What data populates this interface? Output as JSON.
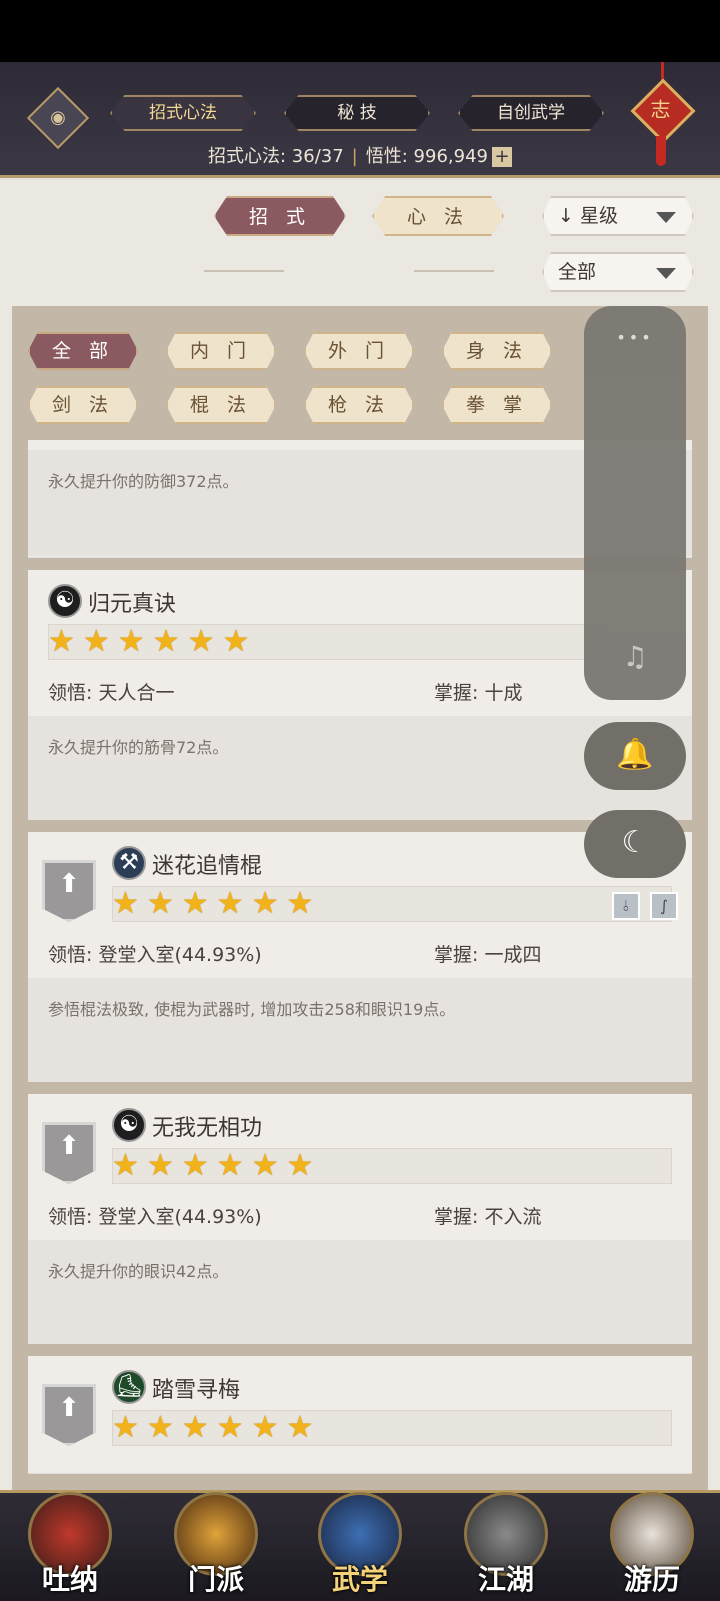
{
  "topbar": {
    "tabs": [
      {
        "label": "招式心法",
        "active": true
      },
      {
        "label": "秘 技",
        "active": false
      },
      {
        "label": "自创武学",
        "active": false
      }
    ],
    "counter_label": "招式心法: 36/37",
    "insight_label": "悟性: 996,949",
    "plus": "+",
    "badge_char": "志"
  },
  "subtabs": {
    "active": "招 式",
    "inactive": "心 法"
  },
  "sort": {
    "label": "星级",
    "arrow": "↓",
    "filter": "全部"
  },
  "chips_row1": [
    "全 部",
    "内 门",
    "外 门",
    "身 法"
  ],
  "chips_row2": [
    "剑 法",
    "棍 法",
    "枪 法",
    "拳 掌"
  ],
  "cards": [
    {
      "desc": "永久提升你的防御372点。"
    },
    {
      "name": "归元真诀",
      "icon": "☯",
      "insight": "领悟: 天人合一",
      "mastery": "掌握: 十成",
      "desc": "永久提升你的筋骨72点。",
      "stars": 6
    },
    {
      "name": "迷花追情棍",
      "icon": "⚒",
      "insight": "领悟: 登堂入室(44.93%)",
      "mastery": "掌握: 一成四",
      "desc": "参悟棍法极致, 使棍为武器时, 增加攻击258和眼识19点。",
      "stars": 6
    },
    {
      "name": "无我无相功",
      "icon": "☯",
      "insight": "领悟: 登堂入室(44.93%)",
      "mastery": "掌握: 不入流",
      "desc": "永久提升你的眼识42点。",
      "stars": 6
    },
    {
      "name": "踏雪寻梅",
      "icon": "⛸",
      "stars": 6
    }
  ],
  "overlay": {
    "dots": "•••",
    "music_icon": "music-off-icon",
    "bell_icon": "bell-icon",
    "moon_icon": "moon-icon"
  },
  "bottomnav": [
    {
      "label": "吐纳",
      "active": false,
      "color": "#c0392b"
    },
    {
      "label": "门派",
      "active": false,
      "color": "#e0a33a"
    },
    {
      "label": "武学",
      "active": true,
      "color": "#3d6fb4"
    },
    {
      "label": "江湖",
      "active": false,
      "color": "#b03030"
    },
    {
      "label": "游历",
      "active": false,
      "color": "#d8d0c8"
    }
  ]
}
